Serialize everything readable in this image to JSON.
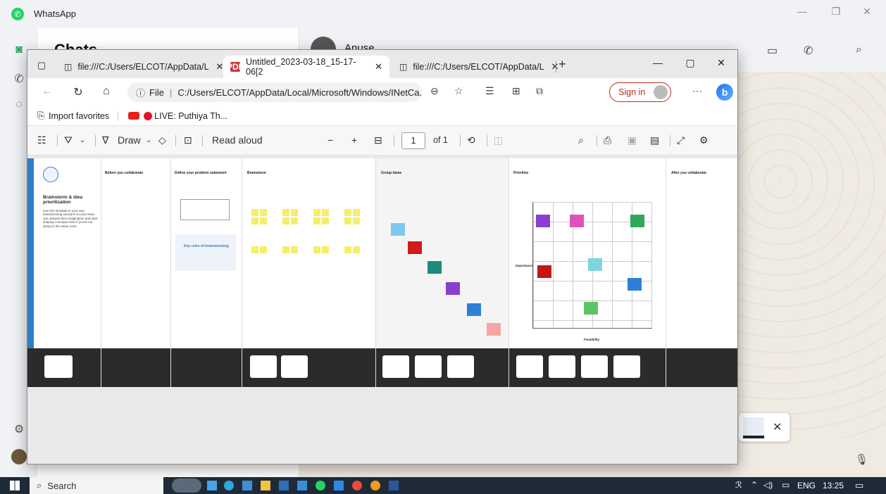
{
  "whatsapp": {
    "title": "WhatsApp",
    "chats_header": "Chats",
    "contact_name": "Anuse"
  },
  "edge": {
    "tabs": [
      {
        "label": "file:///C:/Users/ELCOT/AppData/L",
        "active": false
      },
      {
        "label": "Untitled_2023-03-18_15-17-06[2",
        "active": true
      },
      {
        "label": "file:///C:/Users/ELCOT/AppData/L",
        "active": false
      }
    ],
    "url_prefix": "File",
    "url": "C:/Users/ELCOT/AppData/Local/Microsoft/Windows/INetCa...",
    "sign_in": "Sign in",
    "favorites": {
      "import": "Import favorites",
      "live": "LIVE: Puthiya Th..."
    },
    "pdf_toolbar": {
      "draw": "Draw",
      "read_aloud": "Read aloud",
      "page": "1",
      "of_pages": "of 1"
    }
  },
  "pdf_content": {
    "title": "Brainstorm & idea prioritization",
    "intro": "Use this template in your own brainstorming sessions so your team can unleash their imagination and start shaping concepts even if you're not sitting in the same room.",
    "panels": [
      {
        "heading": "Before you collaborate"
      },
      {
        "heading": "Define your problem statement"
      },
      {
        "heading": "Brainstorm"
      },
      {
        "heading": "Group ideas"
      },
      {
        "heading": "Prioritize"
      },
      {
        "heading": "After you collaborate"
      }
    ],
    "tips_title": "Key rules of brainstorming",
    "axis_x": "Feasibility",
    "axis_y": "Importance"
  },
  "taskbar": {
    "search": "Search",
    "language": "ENG",
    "time": "13:25"
  },
  "colors": {
    "edge_signin": "#c42b1c",
    "sticky_yellow": "#f5ee6b",
    "template_blue": "#2f7ec8",
    "taskbar": "#1f2a38"
  }
}
